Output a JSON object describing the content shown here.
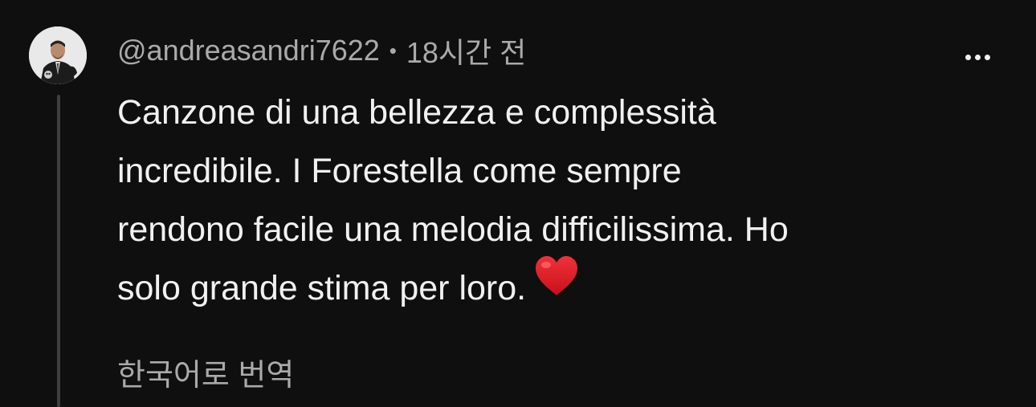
{
  "comment": {
    "author": "@andreasandri7622",
    "separator": "•",
    "timestamp": "18시간 전",
    "text_lines": [
      "Canzone di una bellezza e complessità",
      "incredibile. I Forestella come sempre",
      "rendono facile una melodia difficilissima. Ho",
      "solo grande stima per loro."
    ],
    "emoji": "heart-emoji",
    "translate_label": "한국어로 번역",
    "more_icon": "more-options-icon"
  },
  "colors": {
    "background": "#0f0f0f",
    "primary_text": "#f1f1f1",
    "secondary_text": "#aaaaaa",
    "thread_line": "#3f3f3f",
    "heart": "#e0141e"
  }
}
